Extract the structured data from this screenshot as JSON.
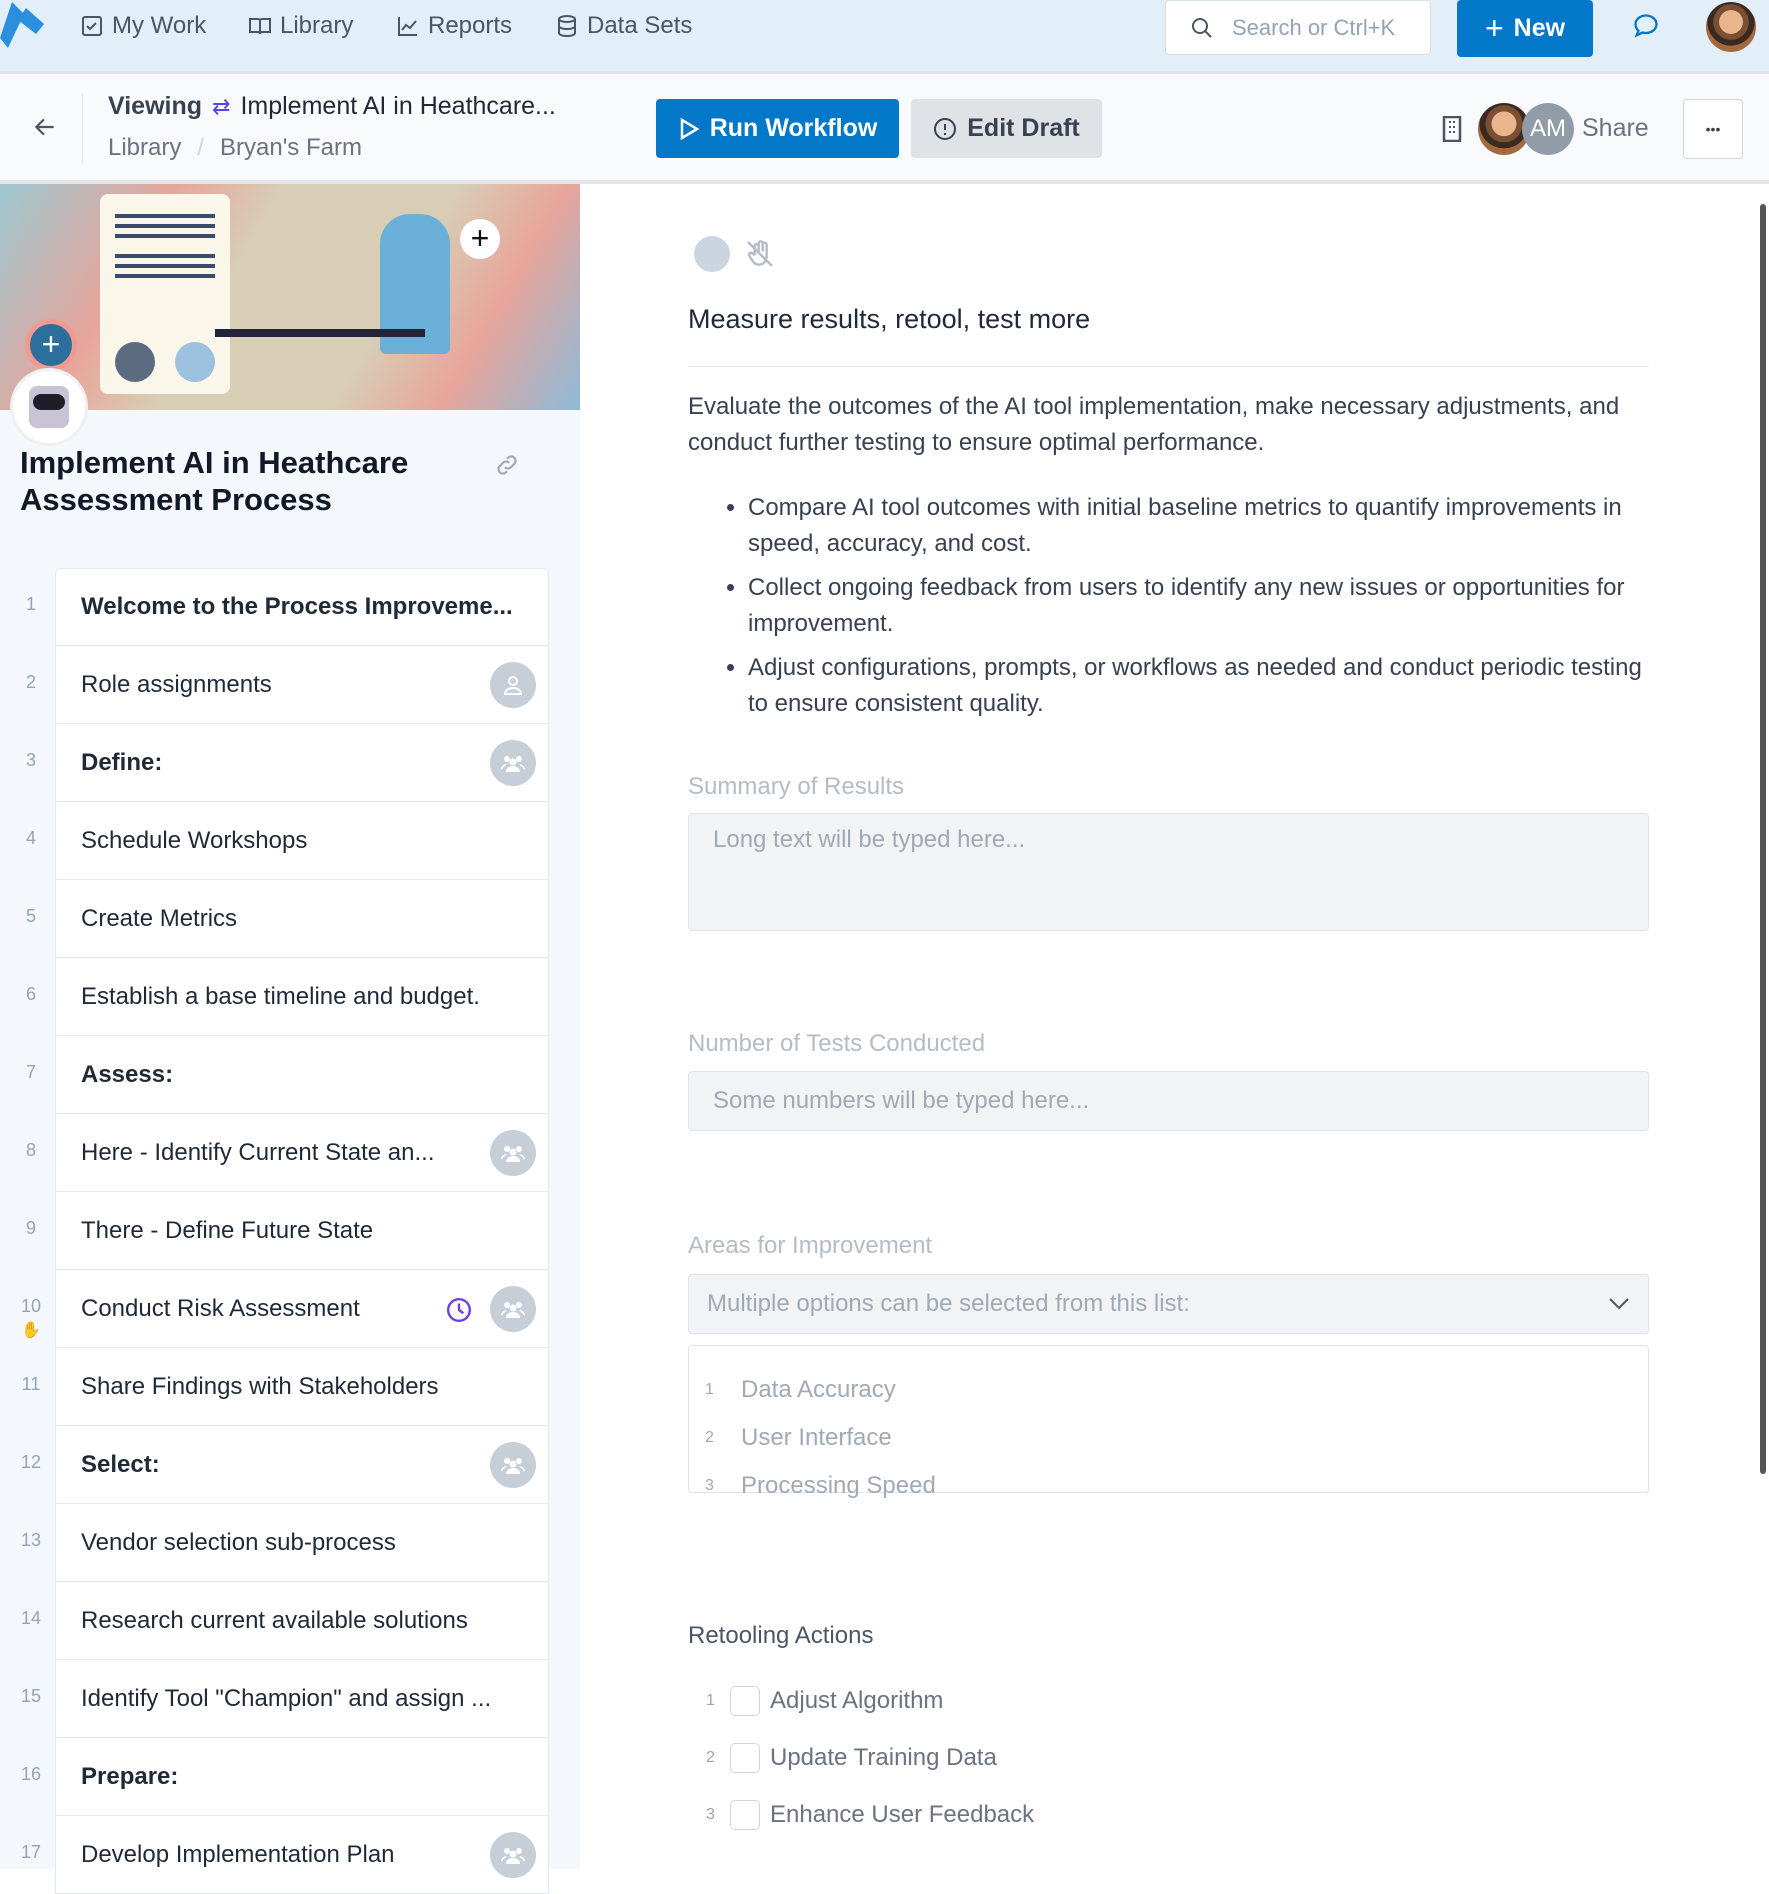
{
  "nav": {
    "items": [
      {
        "label": "My Work",
        "icon": "checkbox-icon"
      },
      {
        "label": "Library",
        "icon": "book-icon"
      },
      {
        "label": "Reports",
        "icon": "chart-icon"
      },
      {
        "label": "Data Sets",
        "icon": "database-icon"
      }
    ],
    "search_placeholder": "Search or Ctrl+K",
    "new_label": "New"
  },
  "header": {
    "viewing_label": "Viewing",
    "title": "Implement AI in Heathcare...",
    "breadcrumb": [
      "Library",
      "Bryan's Farm"
    ],
    "breadcrumb_sep": "/",
    "run_label": "Run Workflow",
    "edit_label": "Edit Draft",
    "avatar_initials": "AM",
    "share_label": "Share",
    "more_label": "•••"
  },
  "workflow": {
    "title": "Implement AI in Heathcare Assessment Process",
    "steps": [
      {
        "num": "1",
        "label": "Welcome to the Process Improveme...",
        "bold": true
      },
      {
        "num": "2",
        "label": "Role assignments",
        "badge": "person"
      },
      {
        "num": "3",
        "label": "Define:",
        "bold": true,
        "badge": "group"
      },
      {
        "num": "4",
        "label": "Schedule Workshops"
      },
      {
        "num": "5",
        "label": "Create Metrics"
      },
      {
        "num": "6",
        "label": "Establish a base timeline and budget."
      },
      {
        "num": "7",
        "label": "Assess:",
        "bold": true
      },
      {
        "num": "8",
        "label": "Here - Identify Current State an...",
        "badge": "group"
      },
      {
        "num": "9",
        "label": "There - Define Future State"
      },
      {
        "num": "10",
        "label": "Conduct Risk Assessment",
        "badge": "group",
        "clock": true,
        "hand": true
      },
      {
        "num": "11",
        "label": "Share Findings with Stakeholders"
      },
      {
        "num": "12",
        "label": "Select:",
        "bold": true,
        "badge": "group"
      },
      {
        "num": "13",
        "label": "Vendor selection sub-process"
      },
      {
        "num": "14",
        "label": "Research current available solutions"
      },
      {
        "num": "15",
        "label": "Identify Tool \"Champion\" and assign ..."
      },
      {
        "num": "16",
        "label": "Prepare:",
        "bold": true
      },
      {
        "num": "17",
        "label": "Develop Implementation Plan",
        "badge": "group"
      }
    ]
  },
  "content": {
    "heading": "Measure results, retool, test more",
    "description": "Evaluate the outcomes of the AI tool implementation, make necessary adjustments, and conduct further testing to ensure optimal performance.",
    "bullets": [
      "Compare AI tool outcomes with initial baseline metrics to quantify improvements in speed, accuracy, and cost.",
      "Collect ongoing feedback from users to identify any new issues or opportunities for improvement.",
      "Adjust configurations, prompts, or workflows as needed and conduct periodic testing to ensure consistent quality."
    ],
    "summary": {
      "label": "Summary of Results",
      "placeholder": "Long text will be typed here..."
    },
    "tests": {
      "label": "Number of Tests Conducted",
      "placeholder": "Some numbers will be typed here..."
    },
    "areas": {
      "label": "Areas for Improvement",
      "placeholder": "Multiple options can be selected from this list:",
      "options": [
        {
          "num": "1",
          "label": "Data Accuracy"
        },
        {
          "num": "2",
          "label": "User Interface"
        },
        {
          "num": "3",
          "label": "Processing Speed"
        }
      ]
    },
    "retooling": {
      "label": "Retooling Actions",
      "items": [
        {
          "num": "1",
          "label": "Adjust Algorithm",
          "checked": false
        },
        {
          "num": "2",
          "label": "Update Training Data",
          "checked": false
        },
        {
          "num": "3",
          "label": "Enhance User Feedback",
          "checked": false
        }
      ]
    }
  },
  "colors": {
    "accent": "#0478c8",
    "nav_bg": "#e3eff8",
    "clock": "#6d3fe0"
  }
}
